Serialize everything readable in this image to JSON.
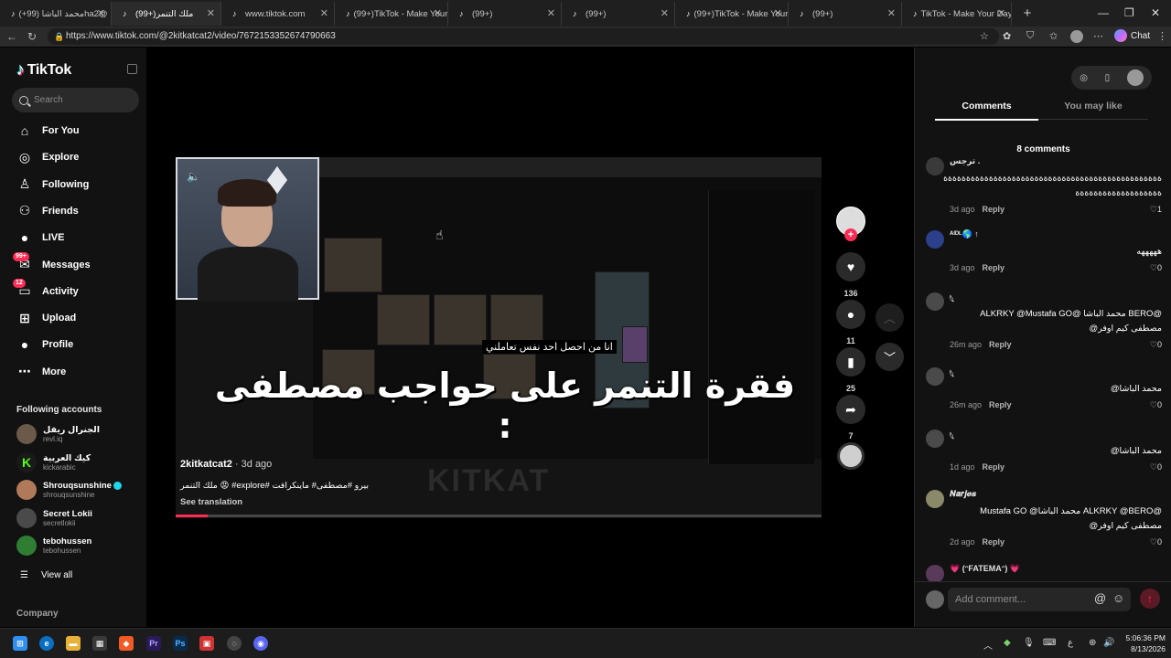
{
  "browser": {
    "tabs": [
      {
        "label": "محمد الباشا (99+)ha2@",
        "active": false
      },
      {
        "label": "(99+)ملك التنمر",
        "active": true
      },
      {
        "label": "www.tiktok.com",
        "active": false
      },
      {
        "label": "(99+)TikTok - Make Your",
        "active": false
      },
      {
        "label": "(99+)",
        "active": false
      },
      {
        "label": "(99+)",
        "active": false
      },
      {
        "label": "(99+)TikTok - Make Your",
        "active": false
      },
      {
        "label": "(99+)",
        "active": false
      },
      {
        "label": "TikTok - Make Your Day",
        "active": false
      }
    ],
    "url": "https://www.tiktok.com/@2kitkatcat2/video/7672153352674790663",
    "chat_label": "Chat"
  },
  "sidebar": {
    "logo": "TikTok",
    "search_placeholder": "Search",
    "nav": [
      {
        "label": "For You",
        "icon": "home-icon"
      },
      {
        "label": "Explore",
        "icon": "compass-icon"
      },
      {
        "label": "Following",
        "icon": "following-icon"
      },
      {
        "label": "Friends",
        "icon": "friends-icon"
      },
      {
        "label": "LIVE",
        "icon": "live-icon"
      },
      {
        "label": "Messages",
        "icon": "messages-icon",
        "badge": "99+"
      },
      {
        "label": "Activity",
        "icon": "activity-icon",
        "badge": "12"
      },
      {
        "label": "Upload",
        "icon": "upload-icon"
      },
      {
        "label": "Profile",
        "icon": "profile-icon"
      },
      {
        "label": "More",
        "icon": "more-icon"
      }
    ],
    "following_title": "Following accounts",
    "accounts": [
      {
        "name": "الجنرال ريفل",
        "handle": "revl.iq"
      },
      {
        "name": "كيك العربية",
        "handle": "kickarabic"
      },
      {
        "name": "Shrouqsunshine",
        "handle": "shrouqsunshine",
        "verified": true
      },
      {
        "name": "Secret Lokii",
        "handle": "secretlokii"
      },
      {
        "name": "tebohussen",
        "handle": "tebohussen"
      }
    ],
    "view_all": "View all",
    "company": "Company"
  },
  "video": {
    "caption": "فقرة التنمر على حواجب مصطفى :",
    "subcaption": "انا من احصل احد نفس تعاملني",
    "watermark": "KITKAT",
    "author": "2kitkatcat2",
    "age": " · 3d ago",
    "description": "بيرو #مصطفى# ماينكرافت #explore# 😡 ملك التنمر",
    "see_translation": "See translation",
    "progress": 0.05
  },
  "actions": {
    "likes": "136",
    "comments": "11",
    "saves": "25",
    "shares": "7"
  },
  "comments_panel": {
    "tab_comments": "Comments",
    "tab_like": "You may like",
    "count_label": "8 comments",
    "comments": [
      {
        "user": "ترجس .",
        "text": "ةةةةةةةةةةةةةةةةةةةةةةةةةةةةةةةةةةةةةةةةةةةةةةةة ةةةةةةةةةةةةةةةةةةة",
        "age": "3d ago",
        "likes": "1"
      },
      {
        "user": "ᴬᴵᴰᴸ🌎 ↑",
        "text": "هههههه",
        "age": "3d ago",
        "likes": "0"
      },
      {
        "user": "𓆩",
        "text": "@BERO محمد الباشا @ALKRKY @Mustafa GO مصطفى كيم اوفر@",
        "age": "26m ago",
        "likes": "0"
      },
      {
        "user": "𓆩",
        "text": "محمد الباشا@",
        "age": "26m ago",
        "likes": "0"
      },
      {
        "user": "𓆩",
        "text": "محمد الباشا@",
        "age": "1d ago",
        "likes": "0"
      },
      {
        "user": "𝑵𝒂𝒓𝒋𝒆𝒔",
        "text": "@ALKRKY @BERO محمد الباشا@ Mustafa GO مصطفى كيم اوفر@",
        "age": "2d ago",
        "likes": "0"
      },
      {
        "user": "💗 (ᵔFATEMAᵔ) 💗",
        "text": "",
        "age": "",
        "likes": ""
      }
    ],
    "reply_label": "Reply",
    "add_comment_placeholder": "Add comment..."
  },
  "taskbar": {
    "time": "5:06:36 PM",
    "date": "8/13/2026"
  }
}
